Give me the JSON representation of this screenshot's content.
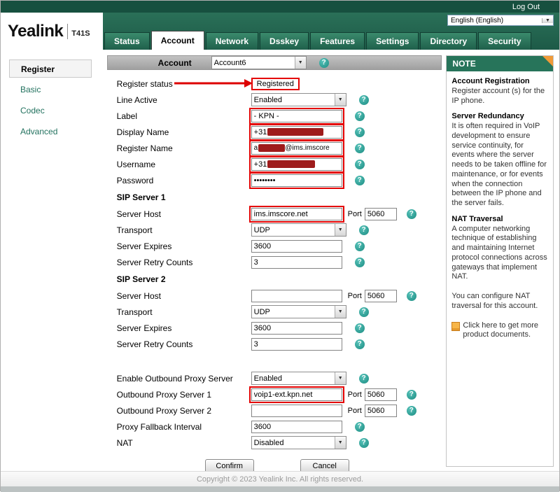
{
  "icons": {
    "help": "?",
    "dropdown": "▼"
  },
  "header": {
    "logout_label": "Log Out",
    "language_value": "English (English)",
    "brand": "Yealink",
    "model": "T41S",
    "active_tab": "Account",
    "tabs": [
      {
        "label": "Status"
      },
      {
        "label": "Account"
      },
      {
        "label": "Network"
      },
      {
        "label": "Dsskey"
      },
      {
        "label": "Features"
      },
      {
        "label": "Settings"
      },
      {
        "label": "Directory"
      },
      {
        "label": "Security"
      }
    ]
  },
  "sidebar": {
    "active_item": "Register",
    "items": [
      {
        "label": "Register"
      },
      {
        "label": "Basic"
      },
      {
        "label": "Codec"
      },
      {
        "label": "Advanced"
      }
    ]
  },
  "form": {
    "account_row": {
      "label": "Account",
      "value": "Account6"
    },
    "register_status": {
      "label": "Register status",
      "value": "Registered"
    },
    "line_active": {
      "label": "Line Active",
      "value": "Enabled"
    },
    "label": {
      "label": "Label",
      "value": "- KPN -"
    },
    "display_name": {
      "label": "Display Name",
      "visible_prefix": "+31"
    },
    "register_name": {
      "label": "Register Name",
      "visible_prefix": "a",
      "visible_suffix": "@ims.imscore"
    },
    "username": {
      "label": "Username",
      "visible_prefix": "+31"
    },
    "password": {
      "label": "Password",
      "value": "••••••••"
    },
    "sip_server_1": {
      "title": "SIP Server 1",
      "server_host": {
        "label": "Server Host",
        "value": "ims.imscore.net",
        "port_label": "Port",
        "port_value": "5060"
      },
      "transport": {
        "label": "Transport",
        "value": "UDP"
      },
      "server_expires": {
        "label": "Server Expires",
        "value": "3600"
      },
      "server_retry_counts": {
        "label": "Server Retry Counts",
        "value": "3"
      }
    },
    "sip_server_2": {
      "title": "SIP Server 2",
      "server_host": {
        "label": "Server Host",
        "value": "",
        "port_label": "Port",
        "port_value": "5060"
      },
      "transport": {
        "label": "Transport",
        "value": "UDP"
      },
      "server_expires": {
        "label": "Server Expires",
        "value": "3600"
      },
      "server_retry_counts": {
        "label": "Server Retry Counts",
        "value": "3"
      }
    },
    "enable_outbound_proxy_server": {
      "label": "Enable Outbound Proxy Server",
      "value": "Enabled"
    },
    "outbound_proxy_server_1": {
      "label": "Outbound Proxy Server 1",
      "value": "voip1-ext.kpn.net",
      "port_label": "Port",
      "port_value": "5060"
    },
    "outbound_proxy_server_2": {
      "label": "Outbound Proxy Server 2",
      "value": "",
      "port_label": "Port",
      "port_value": "5060"
    },
    "proxy_fallback_interval": {
      "label": "Proxy Fallback Interval",
      "value": "3600"
    },
    "nat": {
      "label": "NAT",
      "value": "Disabled"
    },
    "buttons": {
      "confirm": "Confirm",
      "cancel": "Cancel"
    }
  },
  "note": {
    "title": "NOTE",
    "sections": [
      {
        "heading": "Account Registration",
        "body": "Register account (s) for the IP phone."
      },
      {
        "heading": "Server Redundancy",
        "body": "It is often required in VoIP development to ensure service continuity, for events where the server needs to be taken offline for maintenance, or for events when the connection between the IP phone and the server fails."
      },
      {
        "heading": "NAT Traversal",
        "body": "A computer networking technique of establishing and maintaining Internet protocol connections across gateways that implement NAT."
      }
    ],
    "extra": "You can configure NAT traversal for this account.",
    "docs_link": "Click here to get more product documents."
  },
  "footer": {
    "copyright": "Copyright © 2023 Yealink Inc. All rights reserved."
  }
}
